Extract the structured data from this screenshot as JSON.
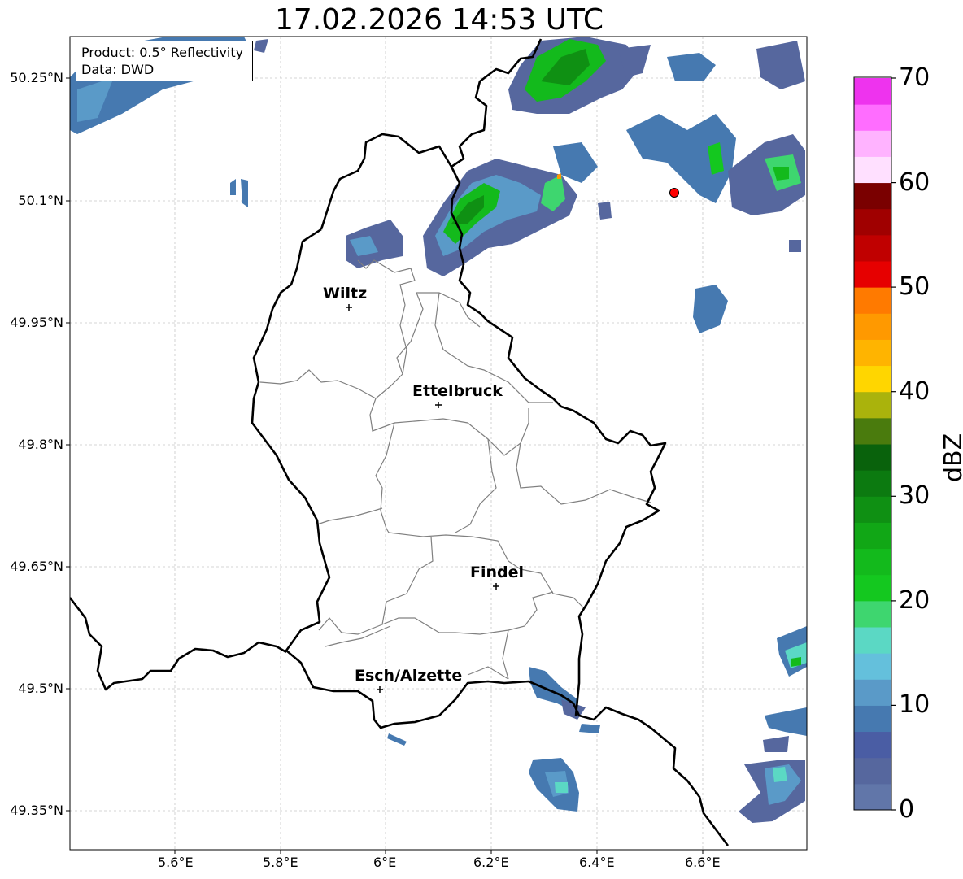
{
  "title": "17.02.2026 14:53 UTC",
  "info": {
    "product": "Product: 0.5° Reflectivity",
    "data": "Data: DWD"
  },
  "axes": {
    "lat_labels": [
      "50.25°N",
      "50.1°N",
      "49.95°N",
      "49.8°N",
      "49.65°N",
      "49.5°N",
      "49.35°N"
    ],
    "lon_labels": [
      "5.6°E",
      "5.8°E",
      "6°E",
      "6.2°E",
      "6.4°E",
      "6.6°E"
    ]
  },
  "cities": [
    {
      "name": "Wiltz"
    },
    {
      "name": "Ettelbruck"
    },
    {
      "name": "Findel"
    },
    {
      "name": "Esch/Alzette"
    }
  ],
  "colorbar": {
    "label": "dBZ",
    "ticks": [
      "0",
      "10",
      "20",
      "30",
      "40",
      "50",
      "60",
      "70"
    ],
    "colors": [
      "#6176a9",
      "#56679e",
      "#4a5da4",
      "#4679b0",
      "#5a9ac8",
      "#64c0dc",
      "#5bd8c4",
      "#3ed66f",
      "#14c81f",
      "#13ba1c",
      "#11a716",
      "#0f9013",
      "#0c7a10",
      "#09620c",
      "#4a7b0d",
      "#aab30c",
      "#ffd600",
      "#ffb400",
      "#ff9900",
      "#ff7a00",
      "#e60000",
      "#c00000",
      "#a00000",
      "#7a0000",
      "#ffe0ff",
      "#ffb3ff",
      "#ff6dff",
      "#ee33ee"
    ]
  },
  "colors": {
    "border": "#000000",
    "districts": "#808080",
    "grid": "#c8c8c8",
    "radar_marker": "#ff0000"
  }
}
